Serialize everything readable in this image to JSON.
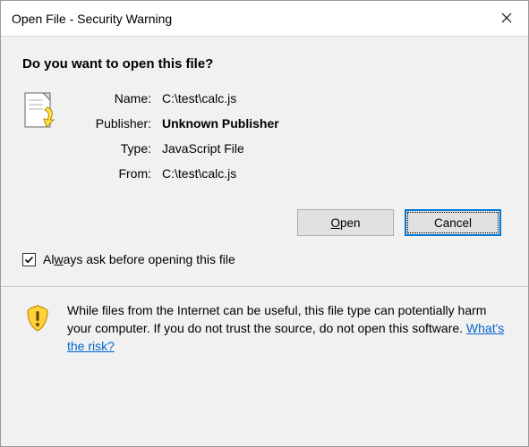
{
  "titlebar": {
    "title": "Open File - Security Warning"
  },
  "question": "Do you want to open this file?",
  "details": {
    "name_label": "Name:",
    "name_value": "C:\\test\\calc.js",
    "publisher_label": "Publisher:",
    "publisher_value": "Unknown Publisher",
    "type_label": "Type:",
    "type_value": "JavaScript File",
    "from_label": "From:",
    "from_value": "C:\\test\\calc.js"
  },
  "buttons": {
    "open_prefix": "",
    "open_accel": "O",
    "open_suffix": "pen",
    "cancel": "Cancel"
  },
  "checkbox": {
    "checked": true,
    "prefix": "Al",
    "accel": "w",
    "suffix": "ays ask before opening this file"
  },
  "footer": {
    "text": "While files from the Internet can be useful, this file type can potentially harm your computer. If you do not trust the source, do not open this software. ",
    "link": "What's the risk?"
  },
  "colors": {
    "accent": "#0078d7",
    "link": "#0066cc",
    "bg": "#f1f1f1"
  }
}
